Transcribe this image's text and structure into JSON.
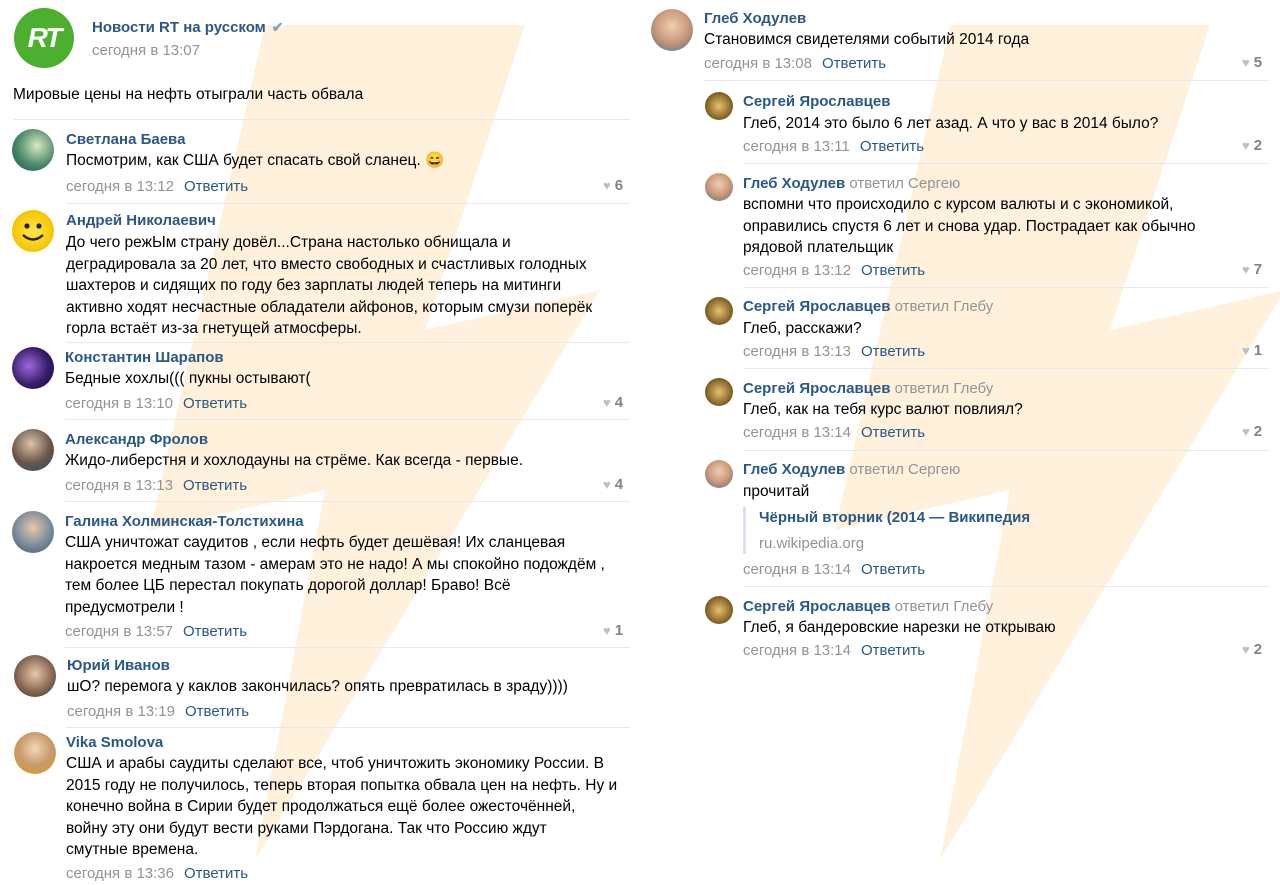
{
  "post": {
    "group_name": "Новости RT на русском",
    "group_logo_text": "RT",
    "date": "сегодня в 13:07",
    "text": "Мировые цены на нефть отыграли часть обвала"
  },
  "reply_label": "Ответить",
  "colors": {
    "link": "#2a5885",
    "muted": "#939393",
    "separator": "#e7e8ec",
    "watermark": "#ffcc80"
  },
  "left_comments": [
    {
      "author": "Светлана Баева",
      "text": "Посмотрим, как США будет спасать свой сланец. 😄",
      "time": "сегодня в 13:12",
      "likes": "6"
    },
    {
      "author": "Андрей Николаевич",
      "text": "До чего режЫм страну довёл...Страна настолько обнищала и\nдеградировала за 20 лет, что вместо свободных и счастливых голодных\nшахтеров и сидящих по году без зарплаты людей теперь на митинги\nактивно ходят несчастные обладатели айфонов, которым смузи поперёк\nгорла встаёт из-за гнетущей атмосферы.",
      "time": "",
      "likes": ""
    },
    {
      "author": "Константин Шарапов",
      "text": "Бедные хохлы((( пукны остывают(",
      "time": "сегодня в 13:10",
      "likes": "4"
    },
    {
      "author": "Александр Фролов",
      "text": "Жидо-либерстня и хохлодауны на стрёме. Как всегда - первые.",
      "time": "сегодня в 13:13",
      "likes": "4"
    },
    {
      "author": "Галина Холминская-Толстихина",
      "text": "США уничтожат саудитов , если нефть будет дешёвая! Их сланцевая\nнакроется медным тазом - амерам это не надо! А мы спокойно подождём ,\nтем более ЦБ перестал покупать дорогой доллар! Браво! Всё\nпредусмотрели !",
      "time": "сегодня в 13:57",
      "likes": "1"
    },
    {
      "author": "Юрий Иванов",
      "text": "шО? перемога у каклов закончилась? опять превратилась в зраду))))",
      "time": "сегодня в 13:19",
      "likes": ""
    },
    {
      "author": "Vika Smolova",
      "text": "США и арабы саудиты сделают все, чтоб уничтожить экономику России. В\n2015 году не получилось, теперь вторая попытка обвала цен на нефть. Ну и\nконечно война в Сирии будет продолжаться ещё более ожесточённей,\nвойну эту они будут вести руками Пэрдогана. Так что Россию ждут\nсмутные времена.",
      "time": "сегодня в 13:36",
      "likes": ""
    }
  ],
  "right_comments": [
    {
      "author": "Глеб Ходулев",
      "replied": "",
      "text": "Становимся свидетелями событий 2014 года",
      "time": "сегодня в 13:08",
      "likes": "5"
    },
    {
      "author": "Сергей Ярославцев",
      "replied": "",
      "text": "Глеб, 2014 это было 6 лет азад. А что у вас в 2014 было?",
      "time": "сегодня в 13:11",
      "likes": "2"
    },
    {
      "author": "Глеб Ходулев",
      "replied": "ответил Сергею",
      "text": "вспомни что происходило с курсом валюты и с экономикой,\nоправились спустя 6 лет и снова удар. Пострадает как обычно\nрядовой плательщик",
      "time": "сегодня в 13:12",
      "likes": "7"
    },
    {
      "author": "Сергей Ярославцев",
      "replied": "ответил Глебу",
      "text": "Глеб, расскажи?",
      "time": "сегодня в 13:13",
      "likes": "1"
    },
    {
      "author": "Сергей Ярославцев",
      "replied": "ответил Глебу",
      "text": "Глеб, как на тебя курс валют повлиял?",
      "time": "сегодня в 13:14",
      "likes": "2"
    },
    {
      "author": "Глеб Ходулев",
      "replied": "ответил Сергею",
      "text": "прочитай",
      "time": "сегодня в 13:14",
      "likes": ""
    },
    {
      "author": "Сергей Ярославцев",
      "replied": "ответил Глебу",
      "text": "Глеб, я бандеровские нарезки не открываю",
      "time": "сегодня в 13:14",
      "likes": "2"
    }
  ],
  "link_card": {
    "title": "Чёрный вторник (2014 — Википедия",
    "domain": "ru.wikipedia.org"
  }
}
